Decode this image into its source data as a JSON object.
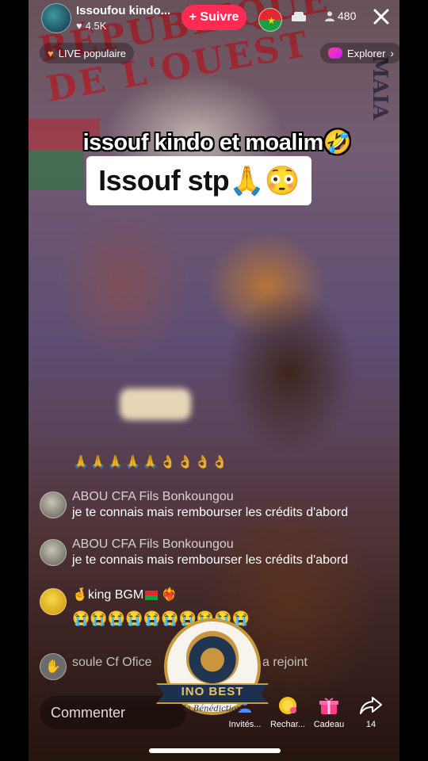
{
  "header": {
    "host_name": "Issoufou kindo...",
    "likes": "4.5K",
    "follow_label": "+ Suivre",
    "viewer_count": "480"
  },
  "chips": {
    "live_label": "LIVE populaire",
    "explore_label": "Explorer"
  },
  "captions": {
    "line1": "issouf kindo et moalim🤣",
    "line2": "Issouf stp🙏😳"
  },
  "reaction_row": "🙏🙏🙏🙏🙏👌👌👌👌",
  "comments": [
    {
      "name": "ABOU CFA Fils Bonkoungou",
      "text": "je te connais mais rembourser les crédits d'abord"
    },
    {
      "name": "ABOU CFA Fils Bonkoungou",
      "text": "je te connais mais rembourser les crédits d'abord"
    },
    {
      "name": "🤞king  BGM",
      "name_suffix": "❤️‍🔥",
      "text": "😭😭😭😭😭😭😭😭😭😭"
    }
  ],
  "join_notice": {
    "name": "soule Cf Ofice",
    "action": "a rejoint"
  },
  "bottom_bar": {
    "comment_placeholder": "Commenter",
    "invites_label": "Invités...",
    "recharge_label": "Rechar...",
    "gift_label": "Cadeau",
    "share_count": "14"
  },
  "watermark": {
    "brand": "INO BEST",
    "tagline": "la Bénédiction"
  },
  "colors": {
    "follow_button": "#fe2c55",
    "logo_gold": "#c79a3c",
    "logo_navy": "#1c3050"
  },
  "icons": [
    "avatar",
    "heart-icon",
    "flag-burkina-faso",
    "sofa-icon",
    "person-icon",
    "close-icon",
    "flame-heart-icon",
    "explore-icon",
    "chevron-right-icon",
    "invite-icon",
    "coin-icon",
    "gift-icon",
    "share-icon",
    "wave-icon"
  ]
}
